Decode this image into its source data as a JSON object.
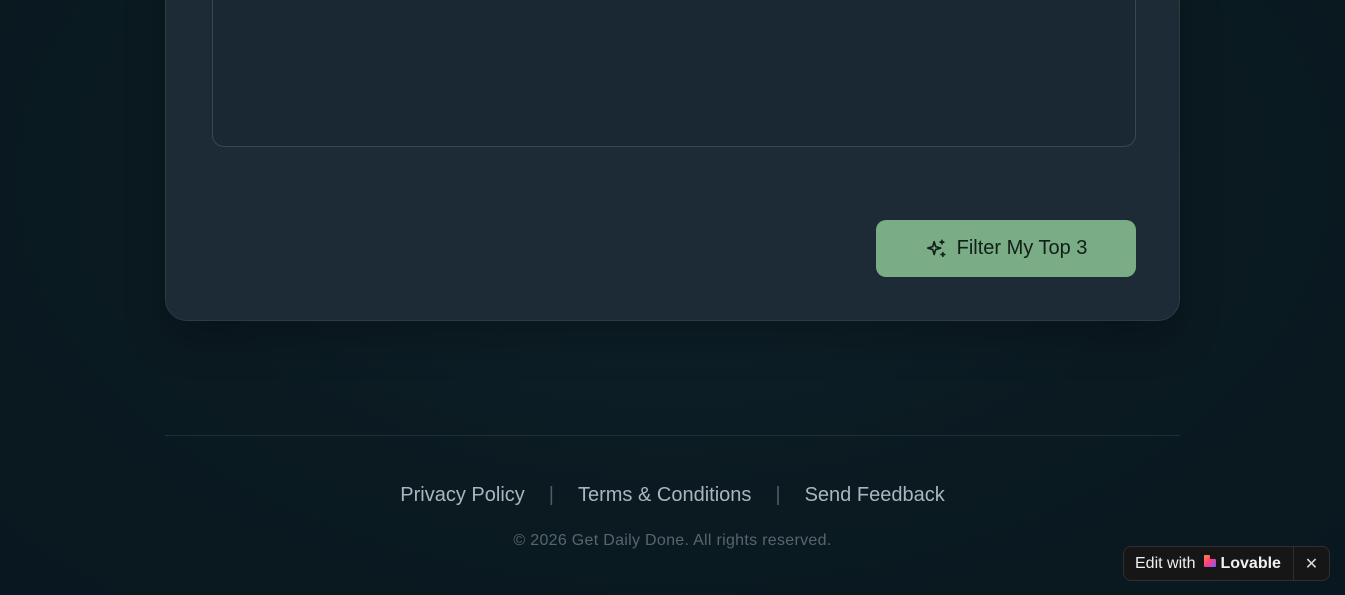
{
  "main": {
    "textarea_value": "",
    "filter_button_label": "Filter My Top 3",
    "filter_button_icon": "sparkles-icon"
  },
  "footer": {
    "links": [
      "Privacy Policy",
      "Terms & Conditions",
      "Send Feedback"
    ],
    "separator": "|",
    "copyright": "© 2026 Get Daily Done. All rights reserved."
  },
  "badge": {
    "label": "Edit with",
    "brand": "Lovable",
    "close": "✕"
  },
  "colors": {
    "background": "#0b1a21",
    "card": "#1c2b36",
    "button": "#7aac86",
    "button_text": "#102018"
  }
}
